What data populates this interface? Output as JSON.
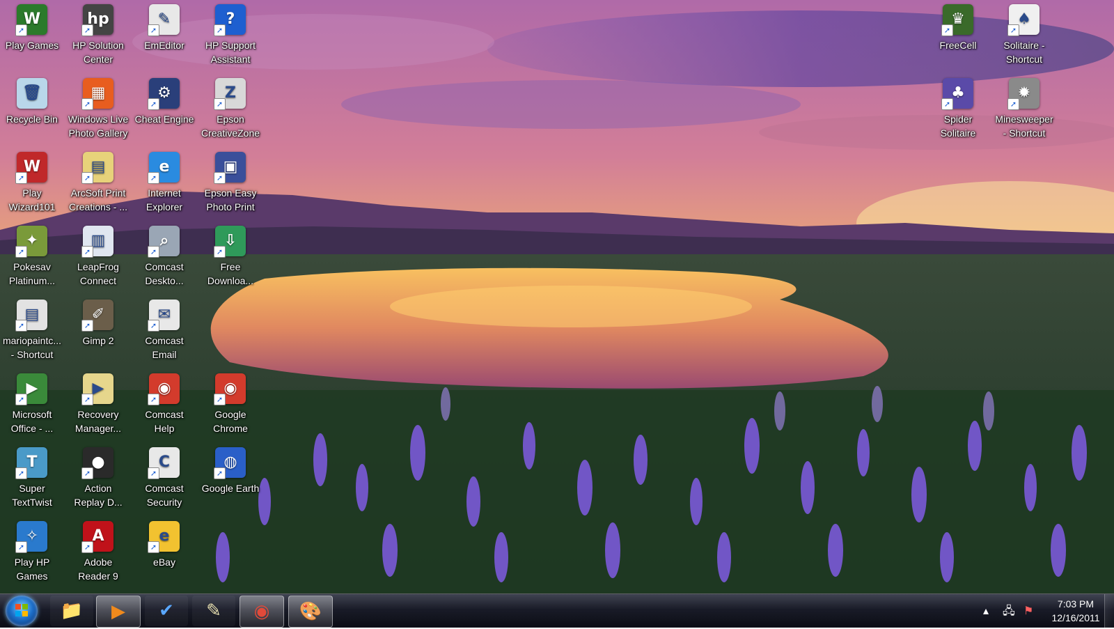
{
  "desktop": {
    "icons": [
      {
        "id": "play-games",
        "lines": [
          "Play Games",
          ""
        ],
        "glyph": "W",
        "bg": "#2b7a2b",
        "shortcut": true
      },
      {
        "id": "hp-solution-center",
        "lines": [
          "HP Solution",
          "Center"
        ],
        "glyph": "hp",
        "bg": "#444444",
        "shortcut": true
      },
      {
        "id": "emeditor",
        "lines": [
          "EmEditor",
          ""
        ],
        "glyph": "✎",
        "bg": "#e8e8e8",
        "shortcut": true
      },
      {
        "id": "hp-support-assistant",
        "lines": [
          "HP Support",
          "Assistant"
        ],
        "glyph": "?",
        "bg": "#1e5fd0",
        "shortcut": true
      },
      {
        "id": "recycle-bin",
        "lines": [
          "Recycle Bin",
          ""
        ],
        "glyph": "🗑",
        "bg": "#b9d7ea",
        "shortcut": false
      },
      {
        "id": "windows-live-photo-gallery",
        "lines": [
          "Windows Live",
          "Photo Gallery"
        ],
        "glyph": "▦",
        "bg": "#e85d1f",
        "shortcut": true
      },
      {
        "id": "cheat-engine",
        "lines": [
          "Cheat Engine",
          ""
        ],
        "glyph": "⚙",
        "bg": "#2a3f7a",
        "shortcut": true
      },
      {
        "id": "epson-creativezone",
        "lines": [
          "Epson",
          "CreativeZone"
        ],
        "glyph": "Z",
        "bg": "#d8d8d8",
        "shortcut": true
      },
      {
        "id": "play-wizard101",
        "lines": [
          "Play",
          "Wizard101"
        ],
        "glyph": "W",
        "bg": "#c0282a",
        "shortcut": true
      },
      {
        "id": "arcsoft-print-creations",
        "lines": [
          "ArcSoft Print",
          "Creations - ..."
        ],
        "glyph": "▤",
        "bg": "#e7d27a",
        "shortcut": true
      },
      {
        "id": "internet-explorer",
        "lines": [
          "Internet",
          "Explorer"
        ],
        "glyph": "e",
        "bg": "#2a8be0",
        "shortcut": true
      },
      {
        "id": "epson-easy-photo-print",
        "lines": [
          "Epson Easy",
          "Photo Print"
        ],
        "glyph": "▣",
        "bg": "#3a4f9a",
        "shortcut": true
      },
      {
        "id": "pokesav-platinum",
        "lines": [
          "Pokesav",
          "Platinum..."
        ],
        "glyph": "✦",
        "bg": "#7a9a3a",
        "shortcut": true
      },
      {
        "id": "leapfrog-connect",
        "lines": [
          "LeapFrog",
          "Connect"
        ],
        "glyph": "▥",
        "bg": "#e0e6f0",
        "shortcut": true
      },
      {
        "id": "comcast-desktop",
        "lines": [
          "Comcast",
          "Deskto..."
        ],
        "glyph": "⌕",
        "bg": "#9aa6b5",
        "shortcut": true
      },
      {
        "id": "free-download",
        "lines": [
          "Free",
          "Downloa..."
        ],
        "glyph": "⇩",
        "bg": "#2f9a5a",
        "shortcut": true
      },
      {
        "id": "mariopaintc-shortcut",
        "lines": [
          "mariopaintc...",
          "- Shortcut"
        ],
        "glyph": "▤",
        "bg": "#e2e2e2",
        "shortcut": true
      },
      {
        "id": "gimp-2",
        "lines": [
          "Gimp 2",
          ""
        ],
        "glyph": "✐",
        "bg": "#6b5e4a",
        "shortcut": true
      },
      {
        "id": "comcast-email",
        "lines": [
          "Comcast",
          "Email"
        ],
        "glyph": "✉",
        "bg": "#e8e8e8",
        "shortcut": true
      },
      {
        "id": "microsoft-office",
        "lines": [
          "Microsoft",
          "Office - ..."
        ],
        "glyph": "▶",
        "bg": "#3a8a3a",
        "shortcut": true
      },
      {
        "id": "recovery-manager",
        "lines": [
          "Recovery",
          "Manager..."
        ],
        "glyph": "▶",
        "bg": "#e6d68c",
        "shortcut": true
      },
      {
        "id": "comcast-help",
        "lines": [
          "Comcast",
          "Help"
        ],
        "glyph": "◉",
        "bg": "#d33b2c",
        "shortcut": true
      },
      {
        "id": "google-chrome",
        "lines": [
          "Google",
          "Chrome"
        ],
        "glyph": "◉",
        "bg": "#d33b2c",
        "shortcut": true
      },
      {
        "id": "super-textwist",
        "lines": [
          "Super",
          "TextTwist"
        ],
        "glyph": "T",
        "bg": "#4a9ac8",
        "shortcut": true
      },
      {
        "id": "action-replay-ds",
        "lines": [
          "Action",
          "Replay D..."
        ],
        "glyph": "●",
        "bg": "#2a2a2a",
        "shortcut": true
      },
      {
        "id": "comcast-security",
        "lines": [
          "Comcast",
          "Security"
        ],
        "glyph": "C",
        "bg": "#e8e8e8",
        "shortcut": true
      },
      {
        "id": "google-earth",
        "lines": [
          "Google Earth",
          ""
        ],
        "glyph": "◍",
        "bg": "#2a5fc8",
        "shortcut": true
      },
      {
        "id": "play-hp-games",
        "lines": [
          "Play HP",
          "Games"
        ],
        "glyph": "✧",
        "bg": "#2a7acd",
        "shortcut": true
      },
      {
        "id": "adobe-reader-9",
        "lines": [
          "Adobe",
          "Reader 9"
        ],
        "glyph": "A",
        "bg": "#c0121a",
        "shortcut": true
      },
      {
        "id": "ebay",
        "lines": [
          "eBay",
          ""
        ],
        "glyph": "e",
        "bg": "#f2c230",
        "shortcut": true
      },
      {
        "id": "freecell",
        "lines": [
          "FreeCell",
          ""
        ],
        "glyph": "♛",
        "bg": "#3a6a2a",
        "shortcut": true
      },
      {
        "id": "solitaire-shortcut",
        "lines": [
          "Solitaire -",
          "Shortcut"
        ],
        "glyph": "♠",
        "bg": "#f0f0f0",
        "shortcut": true
      },
      {
        "id": "spider-solitaire",
        "lines": [
          "Spider",
          "Solitaire"
        ],
        "glyph": "♣",
        "bg": "#5a4aa8",
        "shortcut": true
      },
      {
        "id": "minesweeper-shortcut",
        "lines": [
          "Minesweeper",
          "- Shortcut"
        ],
        "glyph": "✹",
        "bg": "#8a8a8a",
        "shortcut": true
      }
    ]
  },
  "taskbar": {
    "start_icon": "windows-logo",
    "buttons": [
      {
        "id": "windows-explorer",
        "icon": "folder-icon",
        "glyph": "📁",
        "color": "#f2c94c",
        "state": "pinned"
      },
      {
        "id": "windows-media-player",
        "icon": "media-player-icon",
        "glyph": "▶",
        "color": "#f08a1d",
        "state": "active"
      },
      {
        "id": "app-checkmark",
        "icon": "checkmark-icon",
        "glyph": "✔",
        "color": "#5aa8ff",
        "state": "pinned"
      },
      {
        "id": "app-pen",
        "icon": "pen-icon",
        "glyph": "✎",
        "color": "#e8e0b0",
        "state": "pinned"
      },
      {
        "id": "google-chrome",
        "icon": "chrome-icon",
        "glyph": "◉",
        "color": "#e14a3a",
        "state": "active"
      },
      {
        "id": "paint",
        "icon": "paint-palette-icon",
        "glyph": "🎨",
        "color": "#f0c080",
        "state": "active"
      }
    ],
    "tray": {
      "show_hidden_icon": "chevron-up-icon",
      "network_icon": "network-icon",
      "action_center_icon": "action-center-flag-icon",
      "time": "7:03 PM",
      "date": "12/16/2011"
    }
  }
}
